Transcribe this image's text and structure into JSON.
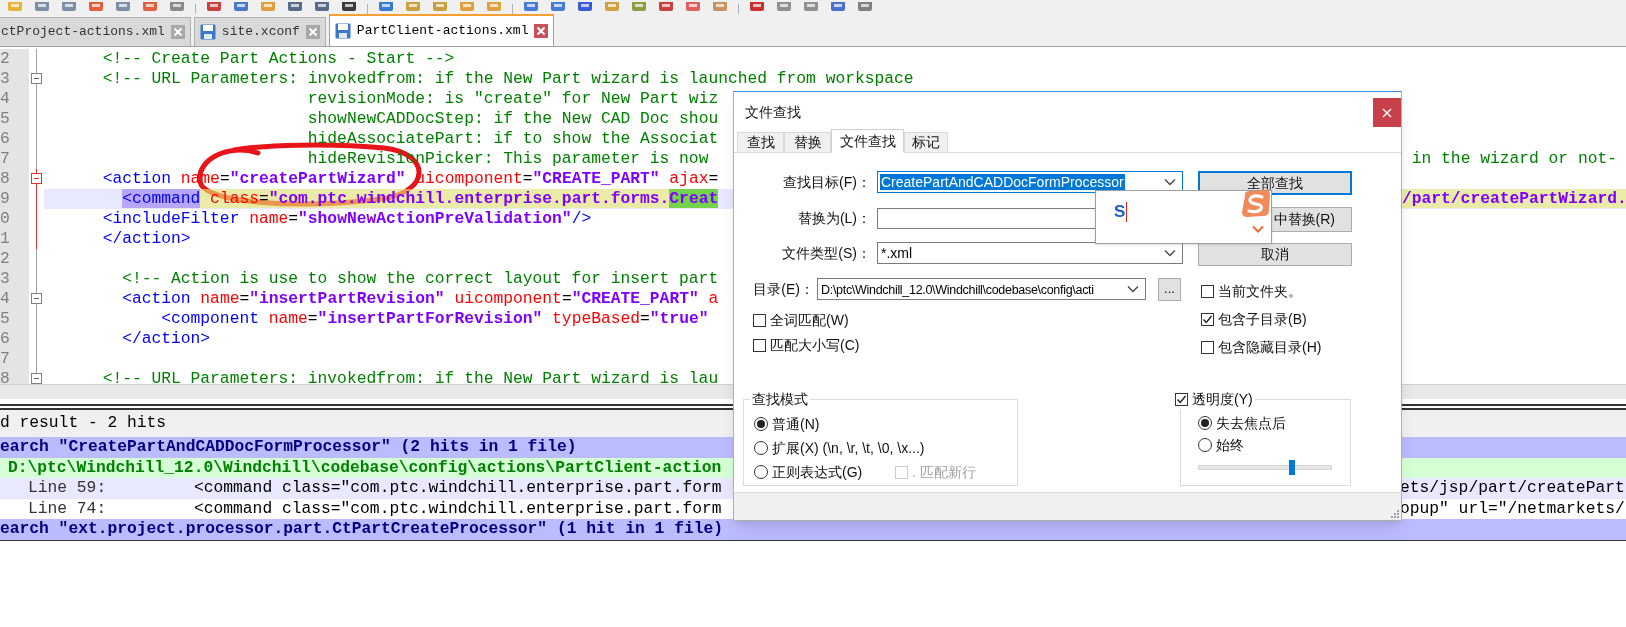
{
  "tabs": [
    {
      "label": "ctProject-actions.xml",
      "selected": false,
      "clipped": true
    },
    {
      "label": "site.xconf",
      "selected": false,
      "clipped": false
    },
    {
      "label": "PartClient-actions.xml",
      "selected": true,
      "clipped": false
    }
  ],
  "editor": {
    "lines": [
      {
        "number": "2",
        "current": false,
        "collapsible": false,
        "fold_active": false,
        "segments": [
          {
            "kind": "comment",
            "text": "      <!-- Create Part Actions - Start -->"
          }
        ]
      },
      {
        "number": "3",
        "current": false,
        "collapsible": true,
        "fold_active": false,
        "segments": [
          {
            "kind": "comment",
            "text": "      <!-- URL Parameters: invokedfrom: if the New Part wizard is launched from workspace"
          }
        ]
      },
      {
        "number": "4",
        "current": false,
        "collapsible": false,
        "fold_active": false,
        "segments": [
          {
            "kind": "comment",
            "text": "                           revisionMode: is \"create\" for New Part wiz"
          }
        ]
      },
      {
        "number": "5",
        "current": false,
        "collapsible": false,
        "fold_active": false,
        "segments": [
          {
            "kind": "comment",
            "text": "                           showNewCADDocStep: if the New CAD Doc shou"
          }
        ]
      },
      {
        "number": "6",
        "current": false,
        "collapsible": false,
        "fold_active": false,
        "segments": [
          {
            "kind": "comment",
            "text": "                           hideAssociatePart: if to show the Associat"
          }
        ]
      },
      {
        "number": "7",
        "current": false,
        "collapsible": false,
        "fold_active": false,
        "segments": [
          {
            "kind": "comment",
            "text": "                           hideRevisionPicker: This parameter is now"
          }
        ],
        "tail": [
          {
            "kind": "comment",
            "text": " in the wizard or not-"
          }
        ]
      },
      {
        "number": "8",
        "current": false,
        "collapsible": true,
        "fold_active": true,
        "segments": [
          {
            "kind": "tag",
            "text": "      <action"
          },
          {
            "kind": "attr",
            "text": " name"
          },
          {
            "kind": "punct",
            "text": "="
          },
          {
            "kind": "value",
            "text": "\"createPartWizard\""
          },
          {
            "kind": "attr",
            "text": " uicomponent"
          },
          {
            "kind": "punct",
            "text": "="
          },
          {
            "kind": "value",
            "text": "\"CREATE_PART\""
          },
          {
            "kind": "attr",
            "text": " ajax"
          },
          {
            "kind": "punct",
            "text": "="
          }
        ]
      },
      {
        "number": "9",
        "current": true,
        "collapsible": false,
        "fold_active": true,
        "segments": [
          {
            "kind": "tag",
            "text": "        <command",
            "brace_match": true
          },
          {
            "kind": "attr",
            "text": " class",
            "highlighted": true
          },
          {
            "kind": "punct",
            "text": "=",
            "highlighted": true
          },
          {
            "kind": "value",
            "text": "\"com.ptc.windchill.enterprise.part.forms.",
            "highlighted": true
          },
          {
            "kind": "value",
            "text": "Creat",
            "found": true
          }
        ],
        "tail": [
          {
            "kind": "value",
            "text": "/part/createPartWizard.",
            "highlighted": true
          }
        ]
      },
      {
        "number": "0",
        "current": false,
        "collapsible": false,
        "fold_active": true,
        "segments": [
          {
            "kind": "tag",
            "text": "      <includeFilter"
          },
          {
            "kind": "attr",
            "text": " name"
          },
          {
            "kind": "punct",
            "text": "="
          },
          {
            "kind": "value",
            "text": "\"showNewActionPreValidation\""
          },
          {
            "kind": "tag",
            "text": "/>"
          }
        ]
      },
      {
        "number": "1",
        "current": false,
        "collapsible": false,
        "fold_active": true,
        "segments": [
          {
            "kind": "tag",
            "text": "      </action>"
          }
        ]
      },
      {
        "number": "2",
        "current": false,
        "collapsible": false,
        "fold_active": false
      },
      {
        "number": "3",
        "current": false,
        "collapsible": false,
        "fold_active": false,
        "segments": [
          {
            "kind": "comment",
            "text": "        <!-- Action is use to show the correct layout for insert part"
          }
        ]
      },
      {
        "number": "4",
        "current": false,
        "collapsible": true,
        "fold_active": false,
        "segments": [
          {
            "kind": "tag",
            "text": "        <action"
          },
          {
            "kind": "attr",
            "text": " name"
          },
          {
            "kind": "punct",
            "text": "="
          },
          {
            "kind": "value",
            "text": "\"insertPartRevision\""
          },
          {
            "kind": "attr",
            "text": " uicomponent"
          },
          {
            "kind": "punct",
            "text": "="
          },
          {
            "kind": "value",
            "text": "\"CREATE_PART\""
          },
          {
            "kind": "attr",
            "text": " a"
          }
        ]
      },
      {
        "number": "5",
        "current": false,
        "collapsible": false,
        "fold_active": false,
        "segments": [
          {
            "kind": "tag",
            "text": "            <component"
          },
          {
            "kind": "attr",
            "text": " name"
          },
          {
            "kind": "punct",
            "text": "="
          },
          {
            "kind": "value",
            "text": "\"insertPartForRevision\""
          },
          {
            "kind": "attr",
            "text": " typeBased"
          },
          {
            "kind": "punct",
            "text": "="
          },
          {
            "kind": "value",
            "text": "\"true\""
          }
        ]
      },
      {
        "number": "6",
        "current": false,
        "collapsible": false,
        "fold_active": false,
        "segments": [
          {
            "kind": "tag",
            "text": "        </action>"
          }
        ]
      },
      {
        "number": "7",
        "current": false,
        "collapsible": false,
        "fold_active": false
      },
      {
        "number": "8",
        "current": false,
        "collapsible": true,
        "fold_active": false,
        "segments": [
          {
            "kind": "comment",
            "text": "      <!-- URL Parameters: invokedfrom: if the New Part wizard is lau"
          }
        ]
      }
    ]
  },
  "results": {
    "header": "d result - 2 hits",
    "rows": [
      {
        "kind": "search",
        "text": "earch \"CreatePartAndCADDocFormProcessor\" (2 hits in 1 file)"
      },
      {
        "kind": "file",
        "text": "D:\\ptc\\Windchill_12.0\\Windchill\\codebase\\config\\actions\\PartClient-action"
      },
      {
        "kind": "hit",
        "current": true,
        "line": "Line 59:",
        "text": "<command class=\"com.ptc.windchill.enterprise.part.form",
        "tail": "ets/jsp/part/createPart"
      },
      {
        "kind": "hit",
        "current": false,
        "line": "Line 74:",
        "text": "<command class=\"com.ptc.windchill.enterprise.part.form",
        "tail": "opup\" url=\"/netmarkets/"
      },
      {
        "kind": "search",
        "text": "earch \"ext.project.processor.part.CtPartCreateProcessor\" (1 hit in 1 file)"
      }
    ]
  },
  "dialog": {
    "title": "文件查找",
    "tabs": [
      {
        "label": "查找",
        "selected": false
      },
      {
        "label": "替换",
        "selected": false
      },
      {
        "label": "文件查找",
        "selected": true
      },
      {
        "label": "标记",
        "selected": false
      }
    ],
    "fields": [
      {
        "label": "查找目标(F)：",
        "kind": "combo",
        "value": "CreatePartAndCADDocFormProcessor",
        "value_selected": true
      },
      {
        "label": "替换为(L)：",
        "kind": "text"
      },
      {
        "label": "文件类型(S)：",
        "kind": "combo",
        "value": "*.xml",
        "value_selected": false
      },
      {
        "label": "目录(E)：",
        "kind": "combo",
        "value": "D:\\ptc\\Windchill_12.0\\Windchill\\codebase\\config\\acti",
        "value_selected": false,
        "browse": "..."
      }
    ],
    "buttons": [
      {
        "label": "全部查找",
        "default": true
      },
      {
        "label": "中替换(R)",
        "default": false
      },
      {
        "label": "取消",
        "default": false
      }
    ],
    "options_left": [
      {
        "label": "全词匹配(W)",
        "checked": false
      },
      {
        "label": "匹配大小写(C)",
        "checked": false
      }
    ],
    "options_right": [
      {
        "label": "当前文件夹。",
        "checked": false
      },
      {
        "label": "包含子目录(B)",
        "checked": true
      },
      {
        "label": "包含隐藏目录(H)",
        "checked": false
      }
    ],
    "search_mode": {
      "title": "查找模式",
      "modes": [
        {
          "label": "普通(N)",
          "selected": true
        },
        {
          "label": "扩展(X) (\\n, \\r, \\t, \\0, \\x...)",
          "selected": false
        },
        {
          "label": "正则表达式(G)",
          "selected": false
        }
      ],
      "dot_newline": {
        "label": ". 匹配新行",
        "checked": false,
        "disabled": true
      }
    },
    "transparency": {
      "label": "透明度(Y)",
      "checked": true,
      "modes": [
        {
          "label": "失去焦点后",
          "selected": true
        },
        {
          "label": "始终",
          "selected": false
        }
      ],
      "level": 0.7
    }
  },
  "ime_popup": {
    "text": "S"
  }
}
